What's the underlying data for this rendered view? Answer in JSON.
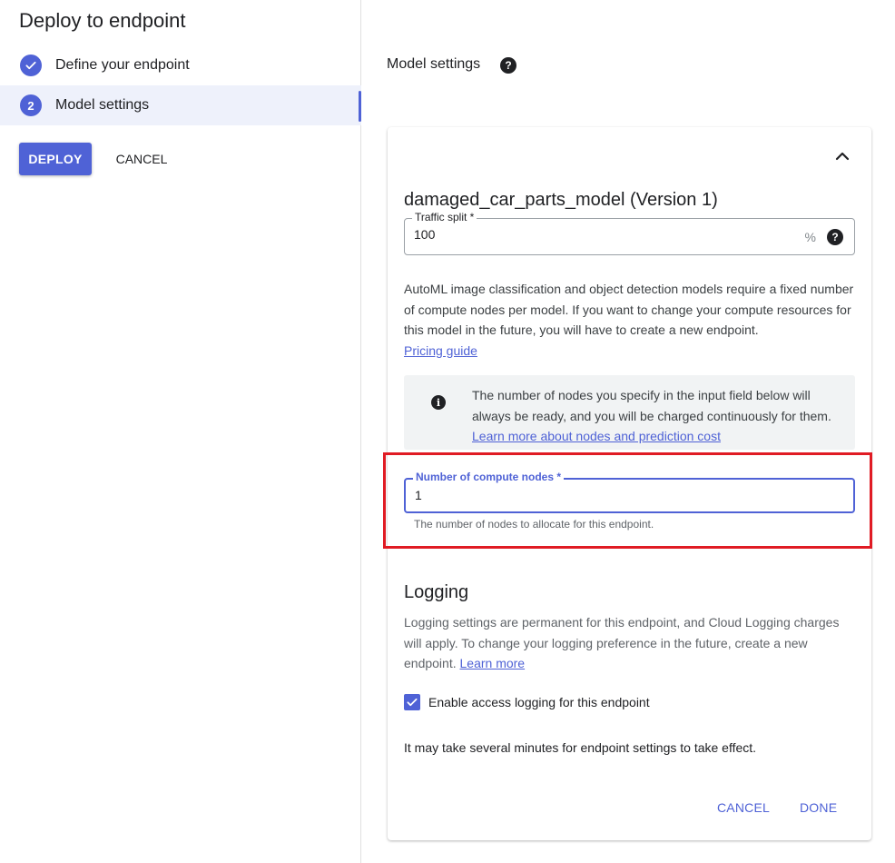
{
  "wizard": {
    "title": "Deploy to endpoint",
    "steps": [
      {
        "number": "1",
        "label": "Define your endpoint",
        "state": "completed"
      },
      {
        "number": "2",
        "label": "Model settings",
        "state": "active"
      }
    ],
    "deploy_label": "DEPLOY",
    "cancel_label": "CANCEL"
  },
  "section": {
    "title": "Model settings",
    "help_icon": "help-circle-icon"
  },
  "card": {
    "model_name": "damaged_car_parts_model (Version 1)",
    "traffic_split": {
      "label": "Traffic split *",
      "value": "100",
      "suffix": "%"
    },
    "description": "AutoML image classification and object detection models require a fixed number of compute nodes per model. If you want to change your compute resources for this model in the future, you will have to create a new endpoint.",
    "pricing_link": "Pricing guide",
    "info": {
      "text": "The number of nodes you specify in the input field below will always be ready, and you will be charged continuously for them.",
      "link": "Learn more about nodes and prediction cost"
    },
    "compute_nodes": {
      "label": "Number of compute nodes *",
      "value": "1",
      "helper": "The number of nodes to allocate for this endpoint."
    },
    "logging": {
      "title": "Logging",
      "description": "Logging settings are permanent for this endpoint, and Cloud Logging charges will apply. To change your logging preference in the future, create a new endpoint.",
      "link": "Learn more",
      "checkbox_label": "Enable access logging for this endpoint",
      "checkbox_checked": true
    },
    "note": "It may take several minutes for endpoint settings to take effect.",
    "cancel_label": "CANCEL",
    "done_label": "DONE"
  },
  "colors": {
    "accent": "#4f62d6",
    "highlight": "#e01b24"
  }
}
